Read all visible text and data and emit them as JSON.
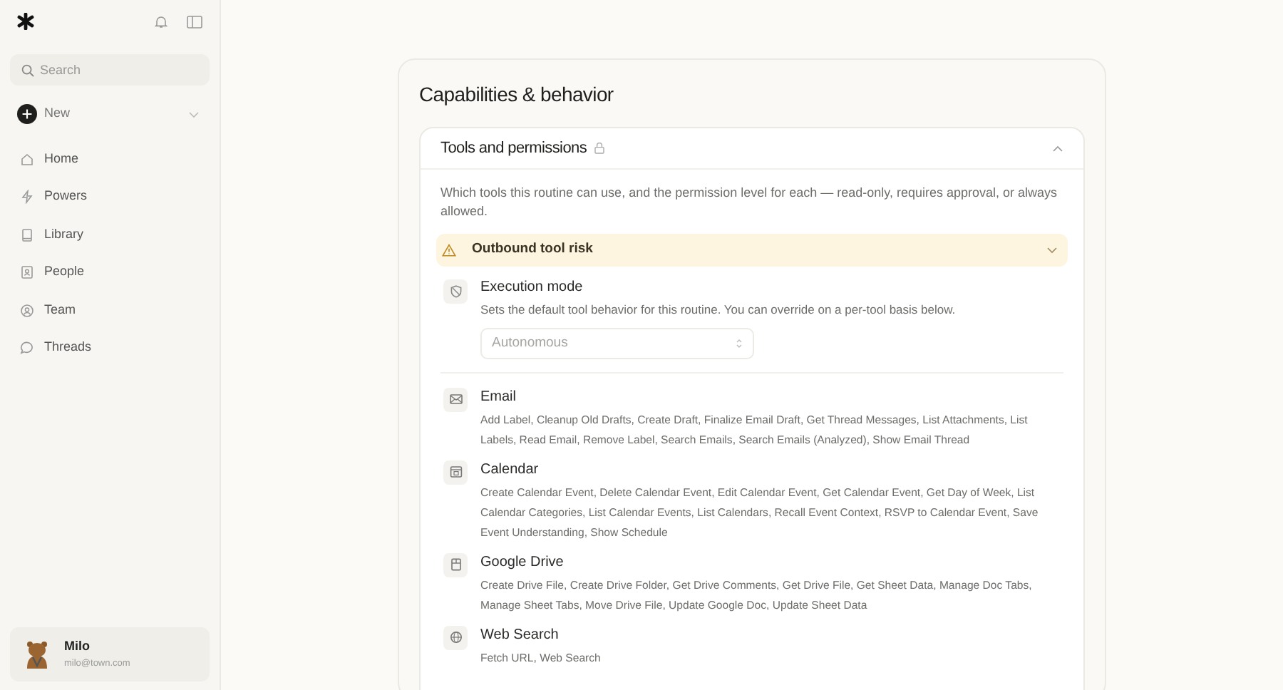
{
  "sidebar": {
    "search": {
      "placeholder": "Search"
    },
    "new_label": "New",
    "nav": [
      {
        "label": "Home",
        "kind": "home"
      },
      {
        "label": "Powers",
        "kind": "powers"
      },
      {
        "label": "Library",
        "kind": "library"
      },
      {
        "label": "People",
        "kind": "people"
      },
      {
        "label": "Team",
        "kind": "team"
      },
      {
        "label": "Threads",
        "kind": "threads"
      }
    ],
    "user": {
      "name": "Milo",
      "email": "milo@town.com"
    }
  },
  "main": {
    "title": "Capabilities & behavior",
    "panel": {
      "title": "Tools and permissions",
      "expanded": true,
      "description": "Which tools this routine can use, and the permission level for each — read-only, requires approval, or always allowed.",
      "warning": {
        "label": "Outbound tool risk",
        "expanded": false
      },
      "execution_mode": {
        "title": "Execution mode",
        "description": "Sets the default tool behavior for this routine. You can override on a per-tool basis below.",
        "value": "Autonomous",
        "disabled": true
      },
      "tools": [
        {
          "kind": "email",
          "name": "Email",
          "actions": "Add Label, Cleanup Old Drafts, Create Draft, Finalize Email Draft, Get Thread Messages, List Attachments, List Labels, Read Email, Remove Label, Search Emails, Search Emails (Analyzed), Show Email Thread"
        },
        {
          "kind": "calendar",
          "name": "Calendar",
          "actions": "Create Calendar Event, Delete Calendar Event, Edit Calendar Event, Get Calendar Event, Get Day of Week, List Calendar Categories, List Calendar Events, List Calendars, Recall Event Context, RSVP to Calendar Event, Save Event Understanding, Show Schedule"
        },
        {
          "kind": "drive",
          "name": "Google Drive",
          "actions": "Create Drive File, Create Drive Folder, Get Drive Comments, Get Drive File, Get Sheet Data, Manage Doc Tabs, Manage Sheet Tabs, Move Drive File, Update Google Doc, Update Sheet Data"
        },
        {
          "kind": "web",
          "name": "Web Search",
          "actions": "Fetch URL, Web Search"
        }
      ]
    }
  }
}
